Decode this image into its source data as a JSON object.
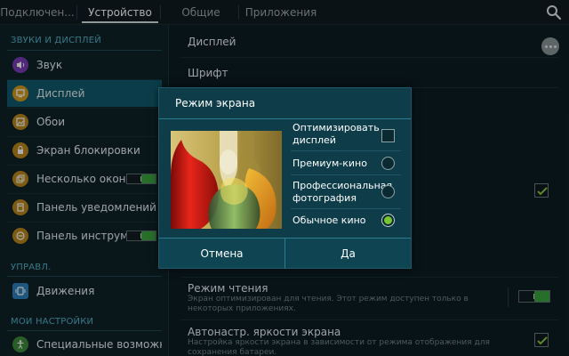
{
  "tabs": [
    {
      "label": "Подключен..."
    },
    {
      "label": "Устройство"
    },
    {
      "label": "Общие"
    },
    {
      "label": "Приложения"
    }
  ],
  "sidebar": {
    "sections": [
      {
        "title": "ЗВУКИ И ДИСПЛЕЙ"
      },
      {
        "title": "УПРАВЛ."
      },
      {
        "title": "МОИ НАСТРОЙКИ"
      }
    ],
    "items": [
      {
        "label": "Звук",
        "icon": "speaker-icon"
      },
      {
        "label": "Дисплей",
        "icon": "display-icon",
        "selected": true
      },
      {
        "label": "Обои",
        "icon": "wallpaper-icon"
      },
      {
        "label": "Экран блокировки",
        "icon": "lock-screen-icon"
      },
      {
        "label": "Несколько окон",
        "icon": "multi-window-icon",
        "toggle": true
      },
      {
        "label": "Панель уведомлений",
        "icon": "notification-panel-icon"
      },
      {
        "label": "Панель инструм...",
        "icon": "toolbox-icon",
        "toggle": true
      },
      {
        "label": "Движения",
        "icon": "motion-icon"
      },
      {
        "label": "Специальные возможно...",
        "icon": "accessibility-icon"
      }
    ]
  },
  "main": {
    "display_title": "Дисплей",
    "font_title": "Шрифт",
    "reading_mode": {
      "title": "Режим чтения",
      "desc": "Экран оптимизирован для чтения. Этот режим доступен только в некоторых приложениях."
    },
    "auto_brightness": {
      "title": "Автонастр. яркости экрана",
      "desc": "Настройка яркости экрана в зависимости от режима отображения для сохранения батареи."
    }
  },
  "dialog": {
    "title": "Режим экрана",
    "options": [
      {
        "label": "Оптимизировать дисплей",
        "type": "checkbox",
        "checked": false
      },
      {
        "label": "Премиум-кино",
        "type": "radio",
        "checked": false
      },
      {
        "label": "Профессиональная фотография",
        "type": "radio",
        "checked": false
      },
      {
        "label": "Обычное кино",
        "type": "radio",
        "checked": true
      }
    ],
    "cancel_label": "Отмена",
    "ok_label": "Да"
  },
  "colors": {
    "accent": "#4fb3c7",
    "selected_bg": "#0f5b6c",
    "toggle_on": "#3aa33f",
    "dialog_bg": "#0e3d49",
    "radio_on": "#78c531"
  }
}
